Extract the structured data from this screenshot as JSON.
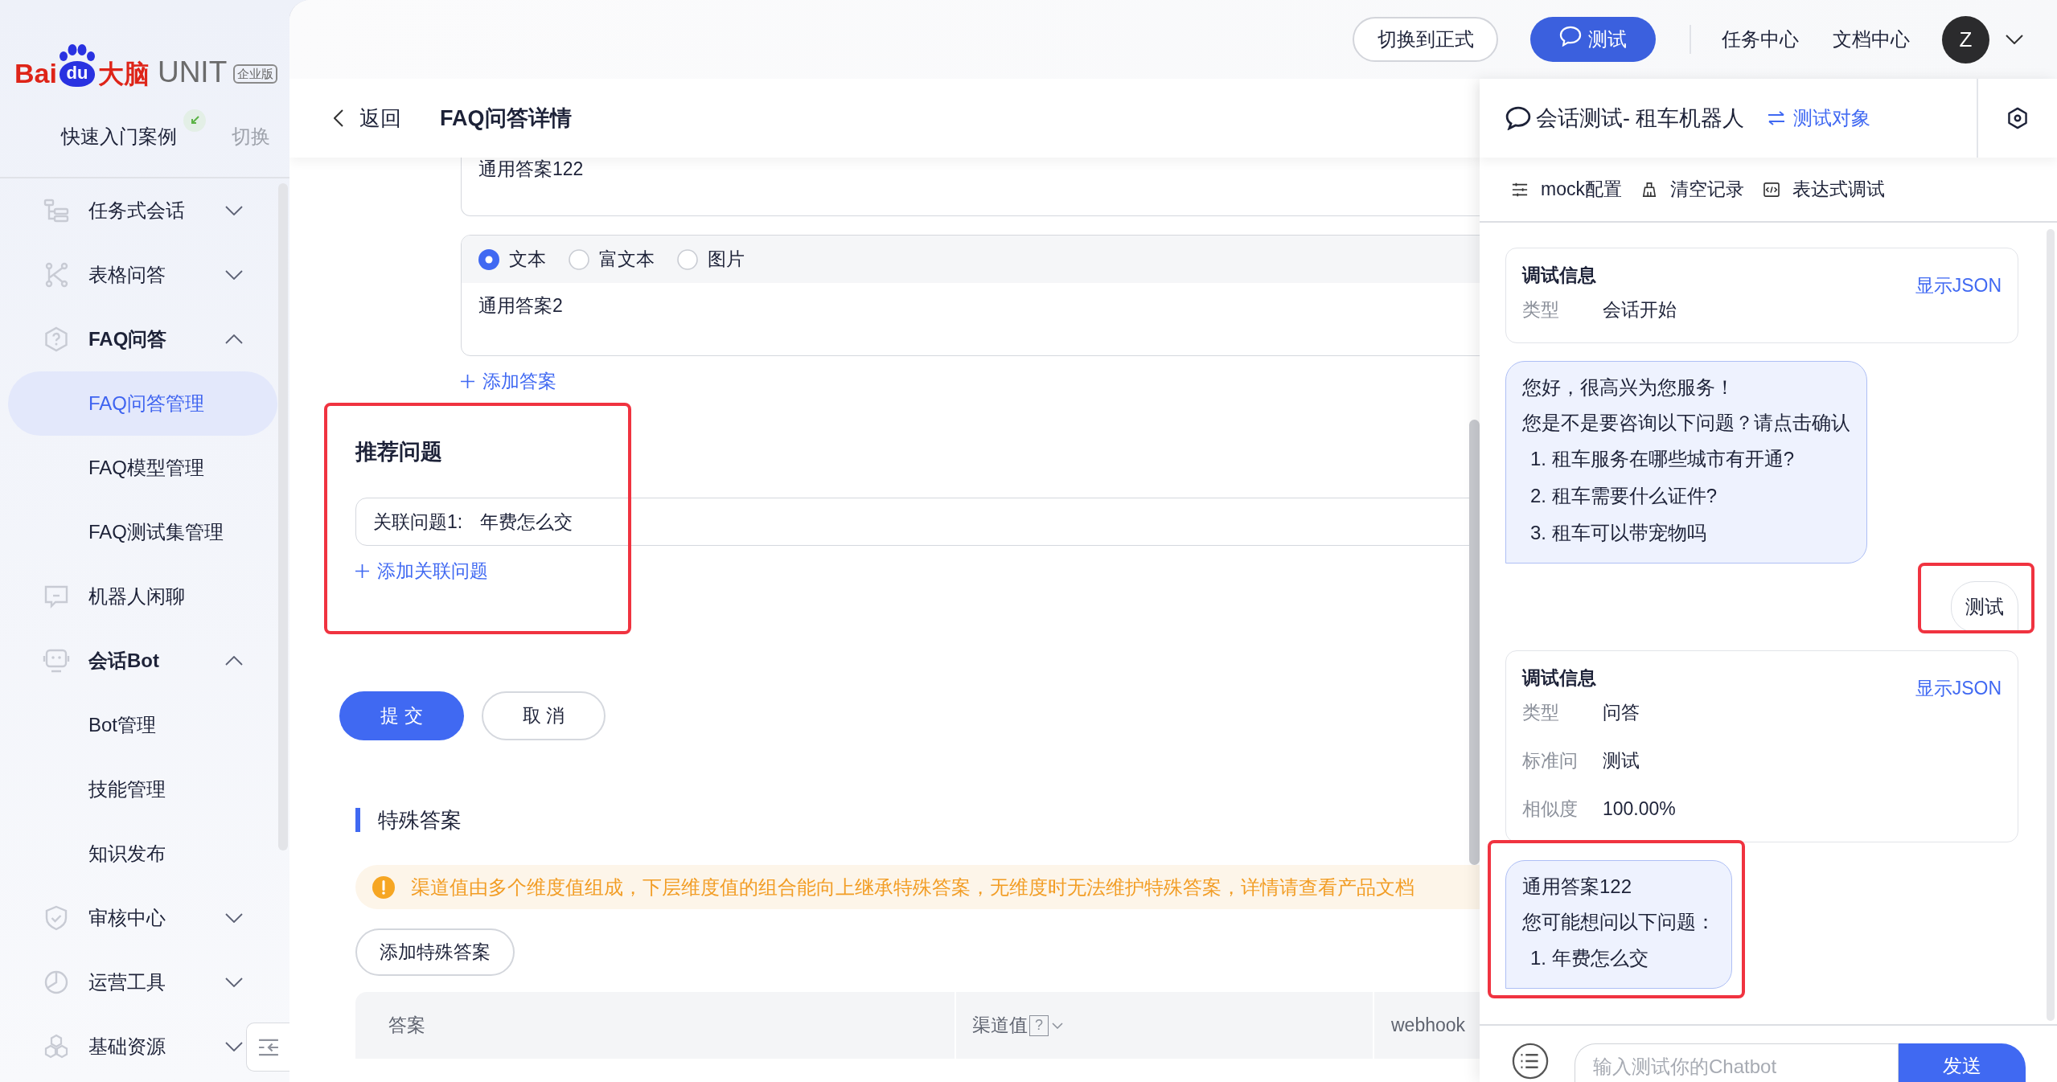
{
  "sidebar": {
    "logo": {
      "brand": "Bai",
      "paw": "du",
      "brand_cn": "大脑",
      "product": "UNIT",
      "edition": "企业版"
    },
    "project": {
      "name": "快速入门案例",
      "switch": "切换"
    },
    "items": [
      {
        "kind": "group",
        "label": "任务式会话",
        "expanded": false
      },
      {
        "kind": "group",
        "label": "表格问答",
        "expanded": false
      },
      {
        "kind": "group",
        "label": "FAQ问答",
        "expanded": true,
        "children": [
          {
            "label": "FAQ问答管理",
            "selected": true
          },
          {
            "label": "FAQ模型管理",
            "selected": false
          },
          {
            "label": "FAQ测试集管理",
            "selected": false
          }
        ]
      },
      {
        "kind": "link",
        "label": "机器人闲聊"
      },
      {
        "kind": "group",
        "label": "会话Bot",
        "expanded": true,
        "children": [
          {
            "label": "Bot管理",
            "selected": false
          },
          {
            "label": "技能管理",
            "selected": false
          },
          {
            "label": "知识发布",
            "selected": false
          }
        ]
      },
      {
        "kind": "group",
        "label": "审核中心",
        "expanded": false
      },
      {
        "kind": "group",
        "label": "运营工具",
        "expanded": false
      },
      {
        "kind": "group",
        "label": "基础资源",
        "expanded": false
      }
    ]
  },
  "top_bar": {
    "buttons": [
      {
        "kind": "outline",
        "label": "切换到正式"
      },
      {
        "kind": "primary",
        "label": "测试"
      }
    ],
    "links": [
      "任务中心",
      "文档中心"
    ],
    "avatar": "Z"
  },
  "page_header": {
    "back": "返回",
    "title": "FAQ问答详情"
  },
  "form": {
    "answers": [
      {
        "text": "通用答案122"
      },
      {
        "types": [
          {
            "label": "文本",
            "selected": true
          },
          {
            "label": "富文本",
            "selected": false
          },
          {
            "label": "图片",
            "selected": false
          }
        ],
        "text": "通用答案2"
      }
    ],
    "add_answer": "添加答案",
    "recommend": {
      "title": "推荐问题",
      "highlighted": true,
      "questions": [
        {
          "label": "关联问题1:",
          "value": "年费怎么交"
        }
      ],
      "add": "添加关联问题"
    },
    "actions": [
      {
        "kind": "primary",
        "label": "提 交"
      },
      {
        "kind": "default",
        "label": "取 消"
      }
    ]
  },
  "special": {
    "title": "特殊答案",
    "notice": "渠道值由多个维度值组成，下层维度值的组合能向上继承特殊答案，无维度时无法维护特殊答案，详情请查看产品文档",
    "add_button": "添加特殊答案",
    "table": {
      "columns": [
        {
          "label": "答案",
          "dropdown": false
        },
        {
          "label": "渠道值",
          "help": "?",
          "dropdown": true
        },
        {
          "label": "webhook",
          "dropdown": false
        }
      ]
    }
  },
  "chat_panel": {
    "title": "会话测试- 租车机器人",
    "switch": "测试对象",
    "tools": [
      "mock配置",
      "清空记录",
      "表达式调试"
    ],
    "messages": [
      {
        "kind": "debug",
        "title": "调试信息",
        "action": "显示JSON",
        "fields": [
          {
            "label": "类型",
            "value": "会话开始"
          }
        ]
      },
      {
        "kind": "bot",
        "highlighted": false,
        "lines": [
          "您好，很高兴为您服务！",
          "您是不是要咨询以下问题？请点击确认"
        ],
        "options": [
          "1. 租车服务在哪些城市有开通?",
          "2. 租车需要什么证件?",
          "3. 租车可以带宠物吗"
        ]
      },
      {
        "kind": "user",
        "highlighted": true,
        "text": "测试"
      },
      {
        "kind": "debug",
        "title": "调试信息",
        "action": "显示JSON",
        "fields": [
          {
            "label": "类型",
            "value": "问答"
          },
          {
            "label": "标准问",
            "value": "测试"
          },
          {
            "label": "相似度",
            "value": "100.00%"
          }
        ]
      },
      {
        "kind": "bot",
        "highlighted": true,
        "lines": [
          "通用答案122",
          "您可能想问以下问题："
        ],
        "options": [
          "1. 年费怎么交"
        ]
      }
    ],
    "input": {
      "placeholder": "输入测试你的Chatbot"
    },
    "send": "发送"
  }
}
